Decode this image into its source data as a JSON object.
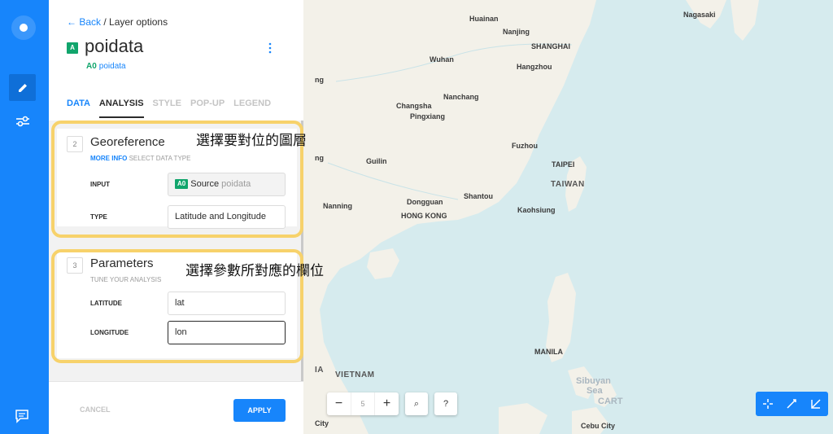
{
  "nav": {
    "back": "Back",
    "breadcrumb": " / Layer options"
  },
  "layer": {
    "badge": "A",
    "title": "poidata",
    "node": "A0",
    "source": "poidata"
  },
  "tabs": [
    {
      "label": "DATA"
    },
    {
      "label": "ANALYSIS"
    },
    {
      "label": "STYLE"
    },
    {
      "label": "POP-UP"
    },
    {
      "label": "LEGEND"
    }
  ],
  "georef": {
    "step": "2",
    "title": "Georeference",
    "more_info": "MORE INFO",
    "subtitle": " SELECT DATA TYPE",
    "input_label": "INPUT",
    "input_chip": "A0",
    "input_source": "Source",
    "input_value": "poidata",
    "type_label": "TYPE",
    "type_value": "Latitude and Longitude"
  },
  "params": {
    "step": "3",
    "title": "Parameters",
    "subtitle": "TUNE YOUR ANALYSIS",
    "lat_label": "LATITUDE",
    "lat_value": "lat",
    "lon_label": "LONGITUDE",
    "lon_value": "lon"
  },
  "annotations": {
    "one": "選擇要對位的圖層",
    "two": "選擇參數所對應的欄位"
  },
  "footer": {
    "cancel": "CANCEL",
    "apply": "APPLY"
  },
  "map": {
    "zoom": "5",
    "zoom_out": "−",
    "zoom_in": "+",
    "search": "⌕",
    "help": "?",
    "cities": [
      "Huainan",
      "Nanjing",
      "SHANGHAI",
      "Wuhan",
      "Hangzhou",
      "Nanchang",
      "Changsha",
      "Pingxiang",
      "Fuzhou",
      "Guilin",
      "TAIPEI",
      "Dongguan",
      "Shantou",
      "Nanning",
      "HONG KONG",
      "Kaohsiung",
      "MANILA",
      "Nagasaki",
      "Cebu City",
      "City"
    ],
    "countries": [
      "TAIWAN",
      "VIETNAM"
    ],
    "seas": [
      "Sibuyan",
      "Sea",
      "CART"
    ],
    "edge_labels": [
      "ng",
      "ng",
      "IA"
    ]
  },
  "colors": {
    "brand": "#1785FB",
    "node": "#11A56C",
    "highlight": "#F7D26B"
  }
}
